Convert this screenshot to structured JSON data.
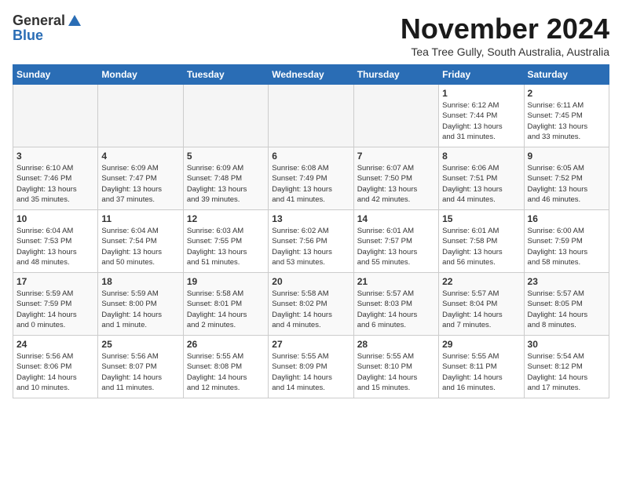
{
  "logo": {
    "general": "General",
    "blue": "Blue"
  },
  "title": "November 2024",
  "location": "Tea Tree Gully, South Australia, Australia",
  "days_header": [
    "Sunday",
    "Monday",
    "Tuesday",
    "Wednesday",
    "Thursday",
    "Friday",
    "Saturday"
  ],
  "weeks": [
    [
      {
        "day": "",
        "info": ""
      },
      {
        "day": "",
        "info": ""
      },
      {
        "day": "",
        "info": ""
      },
      {
        "day": "",
        "info": ""
      },
      {
        "day": "",
        "info": ""
      },
      {
        "day": "1",
        "info": "Sunrise: 6:12 AM\nSunset: 7:44 PM\nDaylight: 13 hours\nand 31 minutes."
      },
      {
        "day": "2",
        "info": "Sunrise: 6:11 AM\nSunset: 7:45 PM\nDaylight: 13 hours\nand 33 minutes."
      }
    ],
    [
      {
        "day": "3",
        "info": "Sunrise: 6:10 AM\nSunset: 7:46 PM\nDaylight: 13 hours\nand 35 minutes."
      },
      {
        "day": "4",
        "info": "Sunrise: 6:09 AM\nSunset: 7:47 PM\nDaylight: 13 hours\nand 37 minutes."
      },
      {
        "day": "5",
        "info": "Sunrise: 6:09 AM\nSunset: 7:48 PM\nDaylight: 13 hours\nand 39 minutes."
      },
      {
        "day": "6",
        "info": "Sunrise: 6:08 AM\nSunset: 7:49 PM\nDaylight: 13 hours\nand 41 minutes."
      },
      {
        "day": "7",
        "info": "Sunrise: 6:07 AM\nSunset: 7:50 PM\nDaylight: 13 hours\nand 42 minutes."
      },
      {
        "day": "8",
        "info": "Sunrise: 6:06 AM\nSunset: 7:51 PM\nDaylight: 13 hours\nand 44 minutes."
      },
      {
        "day": "9",
        "info": "Sunrise: 6:05 AM\nSunset: 7:52 PM\nDaylight: 13 hours\nand 46 minutes."
      }
    ],
    [
      {
        "day": "10",
        "info": "Sunrise: 6:04 AM\nSunset: 7:53 PM\nDaylight: 13 hours\nand 48 minutes."
      },
      {
        "day": "11",
        "info": "Sunrise: 6:04 AM\nSunset: 7:54 PM\nDaylight: 13 hours\nand 50 minutes."
      },
      {
        "day": "12",
        "info": "Sunrise: 6:03 AM\nSunset: 7:55 PM\nDaylight: 13 hours\nand 51 minutes."
      },
      {
        "day": "13",
        "info": "Sunrise: 6:02 AM\nSunset: 7:56 PM\nDaylight: 13 hours\nand 53 minutes."
      },
      {
        "day": "14",
        "info": "Sunrise: 6:01 AM\nSunset: 7:57 PM\nDaylight: 13 hours\nand 55 minutes."
      },
      {
        "day": "15",
        "info": "Sunrise: 6:01 AM\nSunset: 7:58 PM\nDaylight: 13 hours\nand 56 minutes."
      },
      {
        "day": "16",
        "info": "Sunrise: 6:00 AM\nSunset: 7:59 PM\nDaylight: 13 hours\nand 58 minutes."
      }
    ],
    [
      {
        "day": "17",
        "info": "Sunrise: 5:59 AM\nSunset: 7:59 PM\nDaylight: 14 hours\nand 0 minutes."
      },
      {
        "day": "18",
        "info": "Sunrise: 5:59 AM\nSunset: 8:00 PM\nDaylight: 14 hours\nand 1 minute."
      },
      {
        "day": "19",
        "info": "Sunrise: 5:58 AM\nSunset: 8:01 PM\nDaylight: 14 hours\nand 2 minutes."
      },
      {
        "day": "20",
        "info": "Sunrise: 5:58 AM\nSunset: 8:02 PM\nDaylight: 14 hours\nand 4 minutes."
      },
      {
        "day": "21",
        "info": "Sunrise: 5:57 AM\nSunset: 8:03 PM\nDaylight: 14 hours\nand 6 minutes."
      },
      {
        "day": "22",
        "info": "Sunrise: 5:57 AM\nSunset: 8:04 PM\nDaylight: 14 hours\nand 7 minutes."
      },
      {
        "day": "23",
        "info": "Sunrise: 5:57 AM\nSunset: 8:05 PM\nDaylight: 14 hours\nand 8 minutes."
      }
    ],
    [
      {
        "day": "24",
        "info": "Sunrise: 5:56 AM\nSunset: 8:06 PM\nDaylight: 14 hours\nand 10 minutes."
      },
      {
        "day": "25",
        "info": "Sunrise: 5:56 AM\nSunset: 8:07 PM\nDaylight: 14 hours\nand 11 minutes."
      },
      {
        "day": "26",
        "info": "Sunrise: 5:55 AM\nSunset: 8:08 PM\nDaylight: 14 hours\nand 12 minutes."
      },
      {
        "day": "27",
        "info": "Sunrise: 5:55 AM\nSunset: 8:09 PM\nDaylight: 14 hours\nand 14 minutes."
      },
      {
        "day": "28",
        "info": "Sunrise: 5:55 AM\nSunset: 8:10 PM\nDaylight: 14 hours\nand 15 minutes."
      },
      {
        "day": "29",
        "info": "Sunrise: 5:55 AM\nSunset: 8:11 PM\nDaylight: 14 hours\nand 16 minutes."
      },
      {
        "day": "30",
        "info": "Sunrise: 5:54 AM\nSunset: 8:12 PM\nDaylight: 14 hours\nand 17 minutes."
      }
    ]
  ]
}
